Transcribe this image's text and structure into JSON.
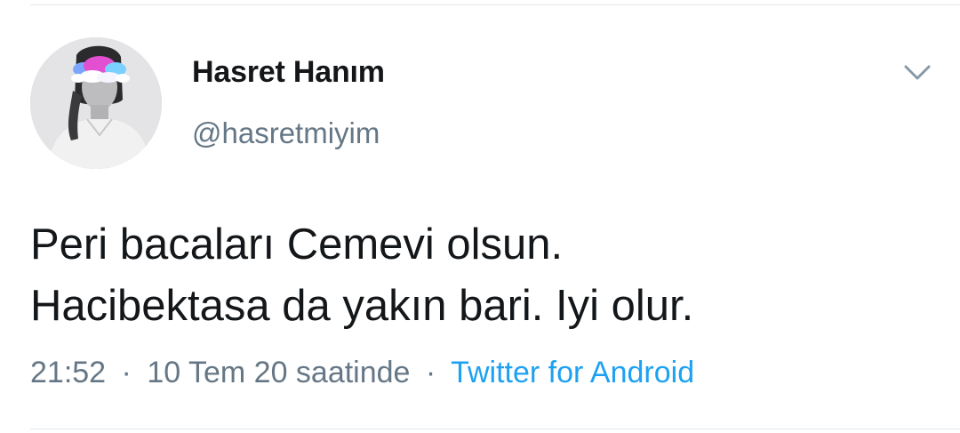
{
  "user": {
    "display_name": "Hasret Hanım",
    "handle": "@hasretmiyim",
    "avatar_icon": "profile-photo"
  },
  "tweet": {
    "lines": [
      "Peri bacaları Cemevi olsun.",
      "Hacibektasa da yakın bari. Iyi olur."
    ],
    "time": "21:52",
    "date": "10 Tem 20 saatinde",
    "separator": "·",
    "source": "Twitter for Android"
  },
  "icons": {
    "menu_caret": "chevron-down-icon"
  },
  "colors": {
    "text_primary": "#14171a",
    "text_secondary": "#657786",
    "link": "#1da1f2",
    "divider": "#e1e8ed"
  }
}
